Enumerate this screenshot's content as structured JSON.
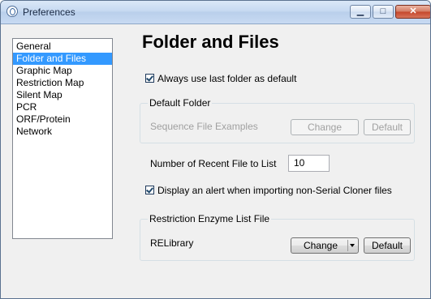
{
  "window": {
    "title": "Preferences",
    "icon": "serial-cloner-app-icon",
    "controls": {
      "minimize": "▁",
      "maximize": "□",
      "close": "✕"
    }
  },
  "sidebar": {
    "items": [
      {
        "label": "General",
        "selected": false
      },
      {
        "label": "Folder and Files",
        "selected": true
      },
      {
        "label": "Graphic Map",
        "selected": false
      },
      {
        "label": "Restriction Map",
        "selected": false
      },
      {
        "label": "Silent Map",
        "selected": false
      },
      {
        "label": "PCR",
        "selected": false
      },
      {
        "label": "ORF/Protein",
        "selected": false
      },
      {
        "label": "Network",
        "selected": false
      }
    ]
  },
  "main": {
    "page_title": "Folder and Files",
    "always_use_last_folder": {
      "label": "Always use last folder as default",
      "checked": true
    },
    "default_folder": {
      "legend": "Default Folder",
      "path_label": "Sequence File Examples",
      "change_label": "Change",
      "default_label": "Default"
    },
    "recent_files": {
      "label": "Number of Recent File to List",
      "value": "10"
    },
    "alert_import": {
      "label": "Display an alert when importing non-Serial Cloner files",
      "checked": true
    },
    "restriction_enzyme": {
      "legend": "Restriction Enzyme List File",
      "file_label": "RELibrary",
      "change_label": "Change",
      "default_label": "Default"
    }
  }
}
